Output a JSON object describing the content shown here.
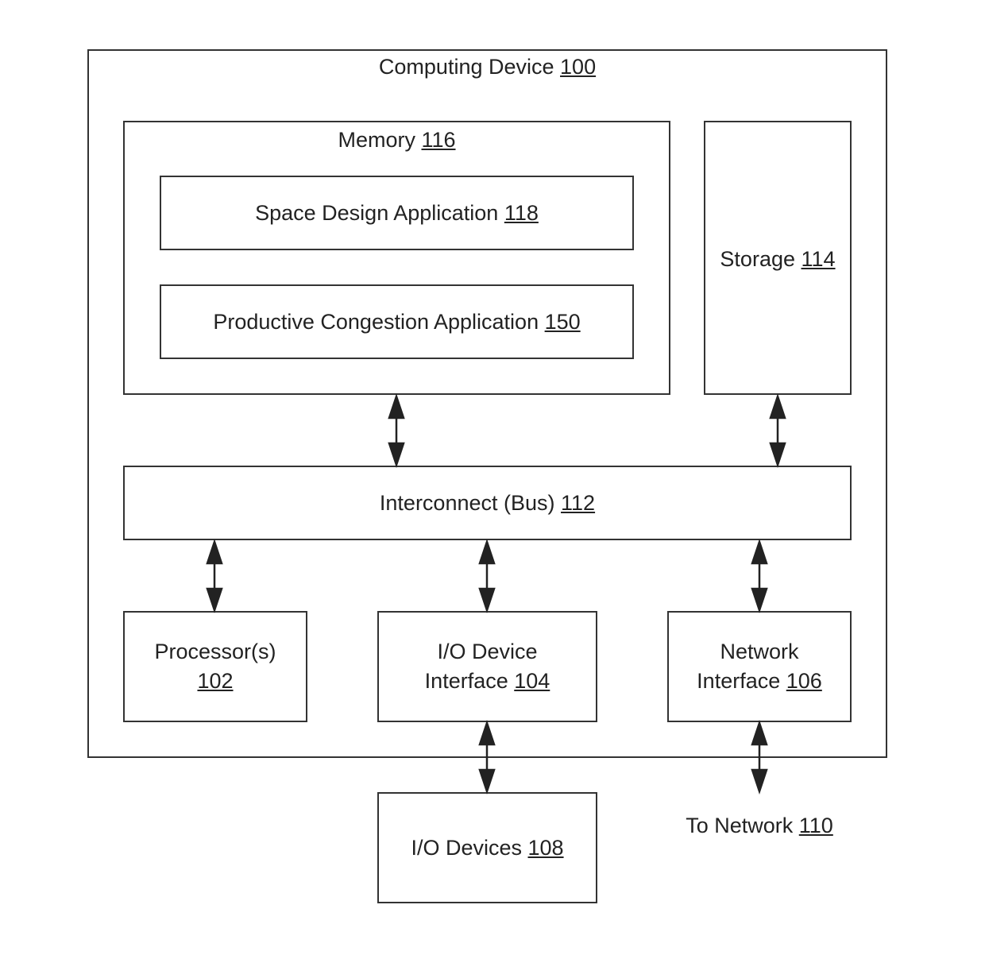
{
  "computing_device": {
    "name": "Computing Device",
    "ref": "100"
  },
  "memory": {
    "name": "Memory",
    "ref": "116"
  },
  "space_design_app": {
    "name": "Space Design Application",
    "ref": "118"
  },
  "productive_congestion_app": {
    "name": "Productive Congestion Application",
    "ref": "150"
  },
  "storage": {
    "name": "Storage",
    "ref": "114"
  },
  "interconnect": {
    "name": "Interconnect (Bus)",
    "ref": "112"
  },
  "processor": {
    "name": "Processor(s)",
    "ref": "102"
  },
  "io_interface": {
    "line1": "I/O Device",
    "line2": "Interface",
    "ref": "104"
  },
  "network_interface": {
    "line1": "Network",
    "line2": "Interface",
    "ref": "106"
  },
  "io_devices": {
    "name": "I/O Devices",
    "ref": "108"
  },
  "to_network": {
    "name": "To Network",
    "ref": "110"
  }
}
